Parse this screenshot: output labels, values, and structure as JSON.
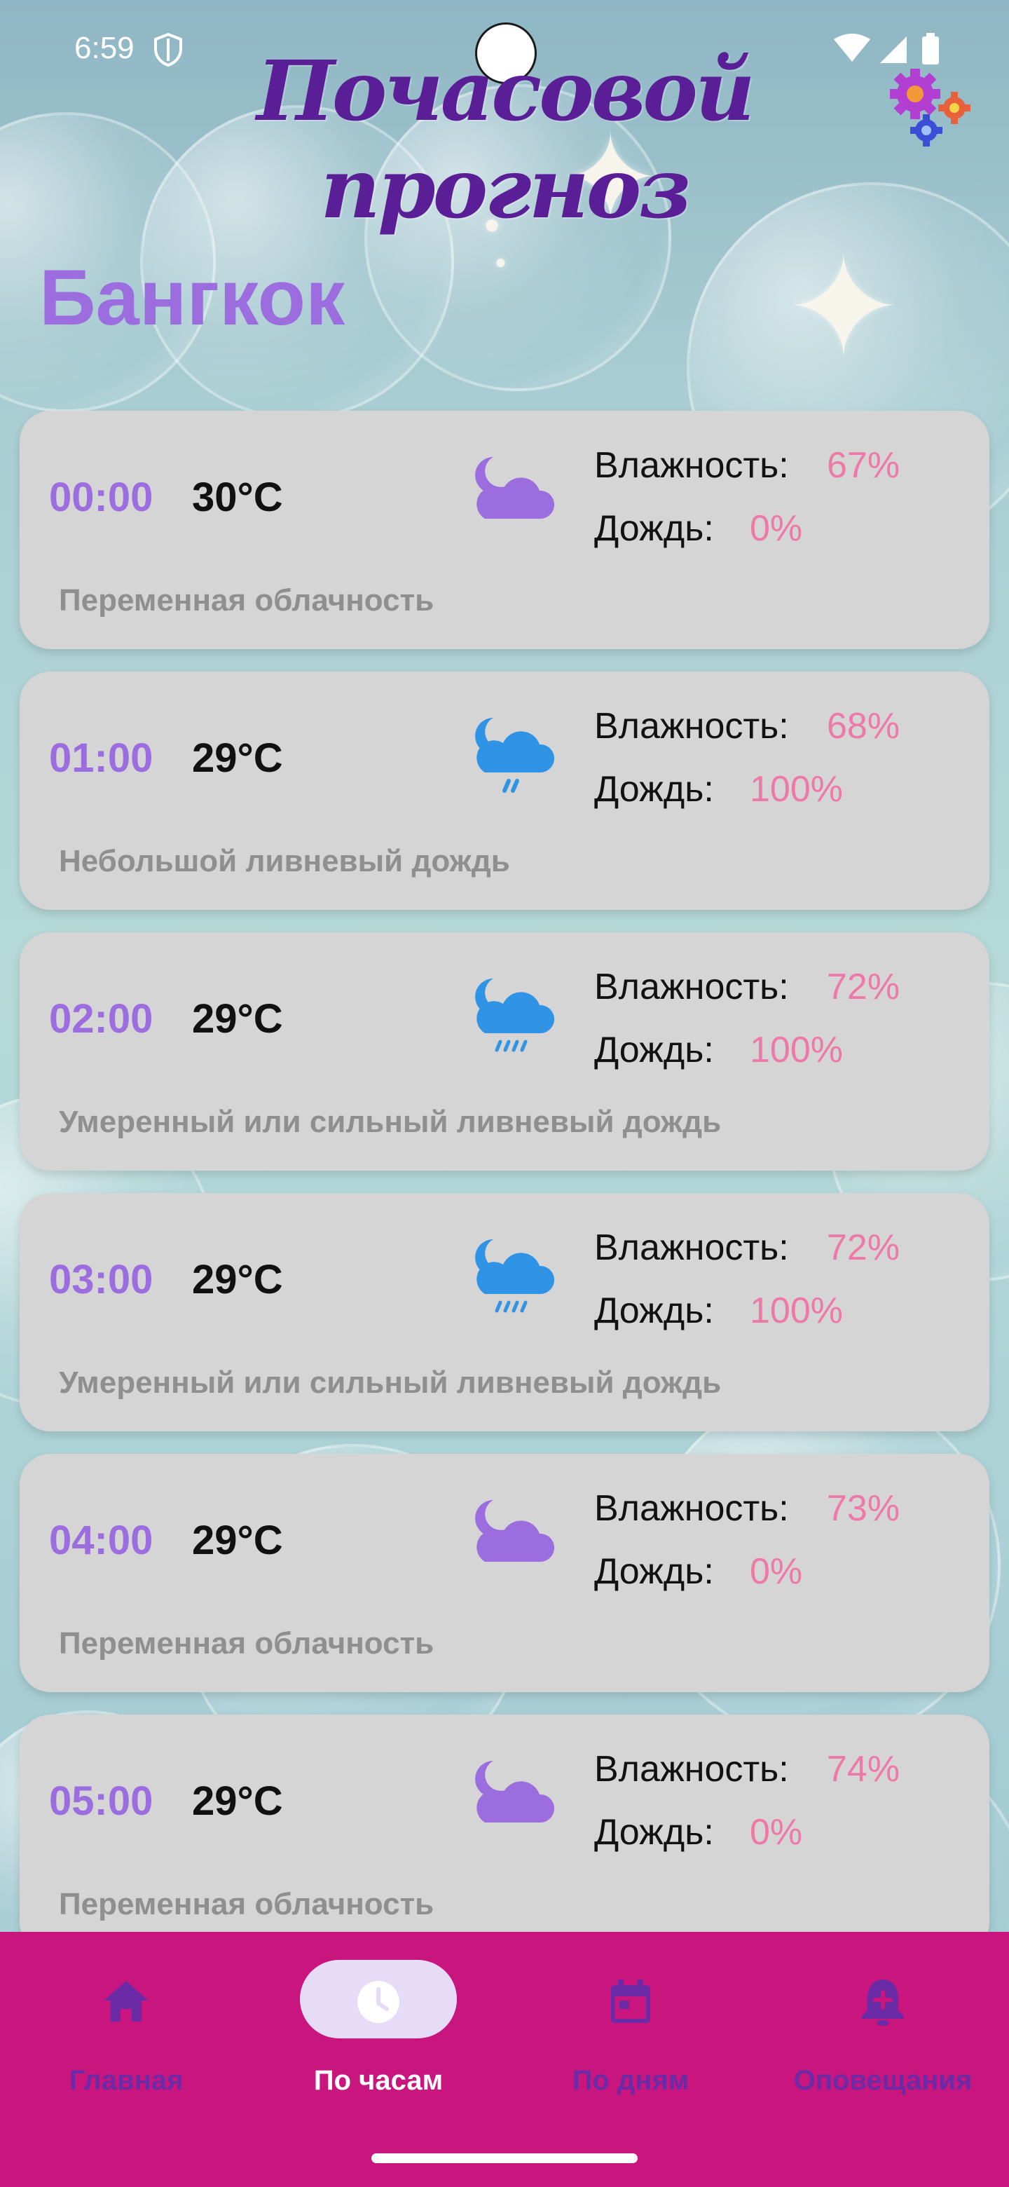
{
  "status_bar": {
    "time": "6:59",
    "icons": [
      "shield-icon",
      "wifi-icon",
      "signal-icon",
      "battery-icon"
    ]
  },
  "header": {
    "title": "Почасовой прогноз",
    "settings_icon": "gears-icon"
  },
  "city": "Бангкок",
  "labels": {
    "humidity": "Влажность:",
    "rain": "Дождь:"
  },
  "forecast": [
    {
      "time": "00:00",
      "temp": "30°C",
      "humidity": "67%",
      "rain": "0%",
      "desc": "Переменная облачность",
      "icon": "moon-cloud-icon",
      "icon_color": "#9b6ddf"
    },
    {
      "time": "01:00",
      "temp": "29°C",
      "humidity": "68%",
      "rain": "100%",
      "desc": "Небольшой ливневый дождь",
      "icon": "moon-cloud-light-rain-icon",
      "icon_color": "#2f93e6"
    },
    {
      "time": "02:00",
      "temp": "29°C",
      "humidity": "72%",
      "rain": "100%",
      "desc": "Умеренный или сильный ливневый дождь",
      "icon": "moon-cloud-heavy-rain-icon",
      "icon_color": "#2f93e6"
    },
    {
      "time": "03:00",
      "temp": "29°C",
      "humidity": "72%",
      "rain": "100%",
      "desc": "Умеренный или сильный ливневый дождь",
      "icon": "moon-cloud-heavy-rain-icon",
      "icon_color": "#2f93e6"
    },
    {
      "time": "04:00",
      "temp": "29°C",
      "humidity": "73%",
      "rain": "0%",
      "desc": "Переменная облачность",
      "icon": "moon-cloud-icon",
      "icon_color": "#9b6ddf"
    },
    {
      "time": "05:00",
      "temp": "29°C",
      "humidity": "74%",
      "rain": "0%",
      "desc": "Переменная облачность",
      "icon": "moon-cloud-icon",
      "icon_color": "#9b6ddf"
    }
  ],
  "nav": {
    "items": [
      {
        "label": "Главная",
        "icon": "home-icon",
        "active": false
      },
      {
        "label": "По часам",
        "icon": "clock-icon",
        "active": true
      },
      {
        "label": "По дням",
        "icon": "calendar-icon",
        "active": false
      },
      {
        "label": "Оповещания",
        "icon": "bell-plus-icon",
        "active": false
      }
    ]
  },
  "colors": {
    "accent_purple": "#9b6ddf",
    "title_purple": "#5a1f96",
    "value_pink": "#ee79a8",
    "nav_background": "#c9157e",
    "card_background": "#d5d5d6"
  }
}
